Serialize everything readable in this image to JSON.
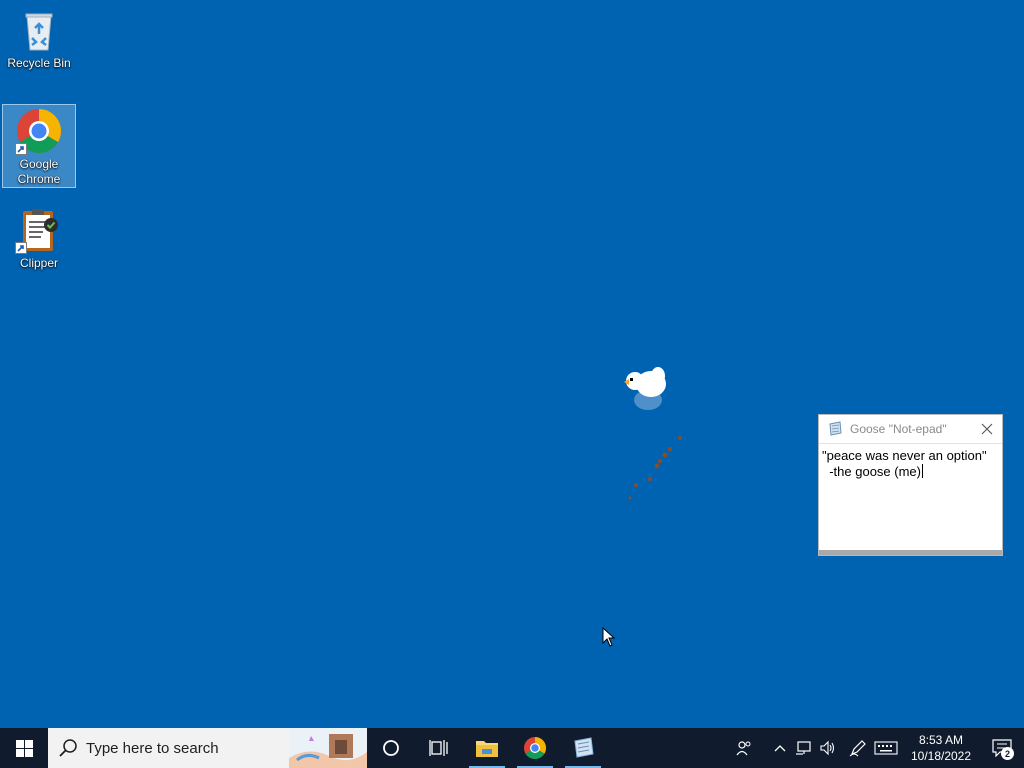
{
  "desktop": {
    "background_color": "#0063b1",
    "icons": [
      {
        "label": "Recycle Bin",
        "icon": "recycle-bin-icon"
      },
      {
        "label": "Google Chrome",
        "icon": "chrome-icon",
        "selected": true,
        "shortcut": true
      },
      {
        "label": "Clipper",
        "icon": "clipboard-icon",
        "shortcut": true
      }
    ]
  },
  "goose_window": {
    "title": "Goose \"Not-epad\"",
    "icon": "notepad-icon",
    "text_lines": [
      "\"peace was never an option\"",
      "  -the goose (me)"
    ]
  },
  "taskbar": {
    "start_icon": "windows-start-icon",
    "search_placeholder": "Type here to search",
    "pinned": [
      {
        "name": "cortana",
        "icon": "cortana-circle-icon"
      },
      {
        "name": "task-view",
        "icon": "task-view-icon"
      },
      {
        "name": "file-explorer",
        "icon": "folder-icon",
        "running": true
      },
      {
        "name": "chrome",
        "icon": "chrome-icon",
        "running": true
      },
      {
        "name": "notepad",
        "icon": "notepad-icon",
        "running": true
      }
    ],
    "tray_icons": [
      "people-icon",
      "chevron-up-icon",
      "network-icon",
      "volume-icon",
      "pen-icon",
      "keyboard-icon"
    ],
    "clock_time": "8:53 AM",
    "clock_date": "10/18/2022",
    "notification_count": "2",
    "accent_color": "#76b9ed"
  }
}
